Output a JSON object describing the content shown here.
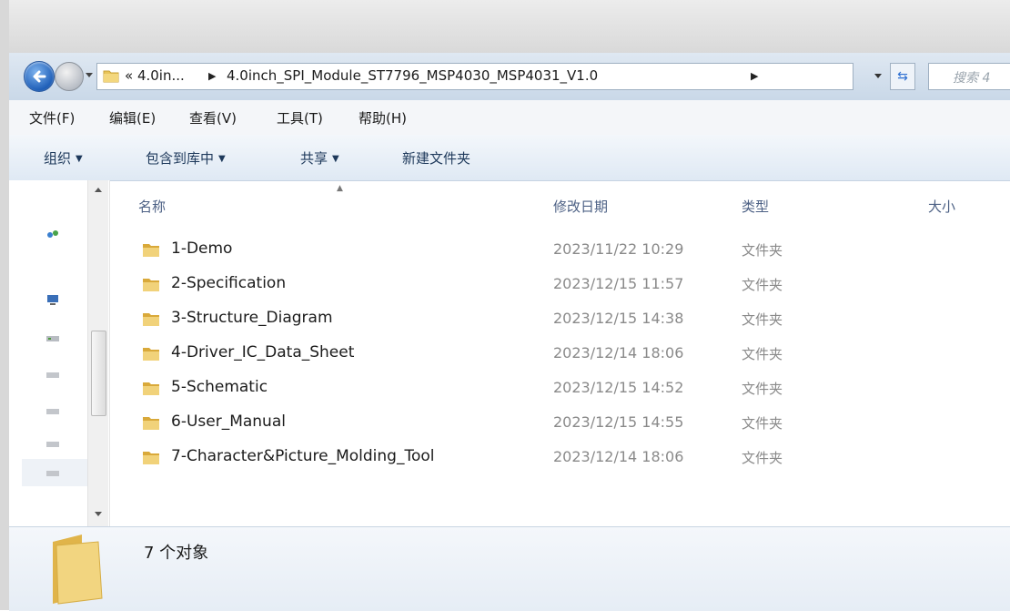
{
  "address": {
    "crumbs": [
      "« 4.0in...",
      "4.0inch_SPI_Module_ST7796_MSP4030_MSP4031_V1.0"
    ],
    "search_placeholder": "搜索 4"
  },
  "menu": [
    "文件(F)",
    "编辑(E)",
    "查看(V)",
    "工具(T)",
    "帮助(H)"
  ],
  "commands": [
    {
      "label": "组织",
      "dropdown": true
    },
    {
      "label": "包含到库中",
      "dropdown": true
    },
    {
      "label": "共享",
      "dropdown": true
    },
    {
      "label": "新建文件夹",
      "dropdown": false
    }
  ],
  "columns": {
    "name": "名称",
    "modified": "修改日期",
    "type": "类型",
    "size": "大小"
  },
  "files": [
    {
      "name": "1-Demo",
      "modified": "2023/11/22 10:29",
      "type": "文件夹",
      "icon": "folder-icon"
    },
    {
      "name": "2-Specification",
      "modified": "2023/12/15 11:57",
      "type": "文件夹",
      "icon": "folder-icon"
    },
    {
      "name": "3-Structure_Diagram",
      "modified": "2023/12/15 14:38",
      "type": "文件夹",
      "icon": "folder-icon"
    },
    {
      "name": "4-Driver_IC_Data_Sheet",
      "modified": "2023/12/14 18:06",
      "type": "文件夹",
      "icon": "folder-icon"
    },
    {
      "name": "5-Schematic",
      "modified": "2023/12/15 14:52",
      "type": "文件夹",
      "icon": "folder-icon"
    },
    {
      "name": "6-User_Manual",
      "modified": "2023/12/15 14:55",
      "type": "文件夹",
      "icon": "folder-icon"
    },
    {
      "name": "7-Character&Picture_Molding_Tool",
      "modified": "2023/12/14 18:06",
      "type": "文件夹",
      "icon": "folder-icon"
    }
  ],
  "status": {
    "count_text": "7 个对象"
  },
  "colors": {
    "folder": "#e8c45a",
    "accent": "#1f5fb8",
    "header_text": "#4d6185"
  }
}
